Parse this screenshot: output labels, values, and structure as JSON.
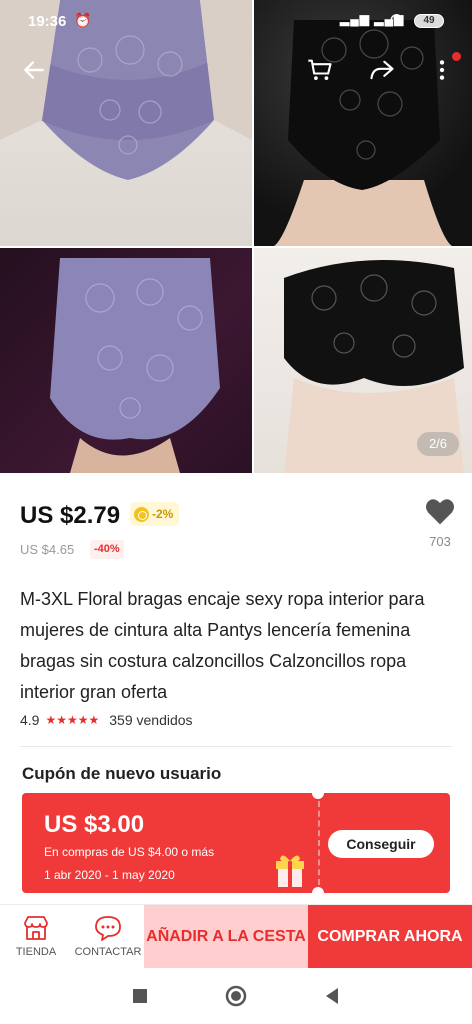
{
  "status_bar": {
    "time": "19:36",
    "battery": "49"
  },
  "gallery": {
    "pager": "2/6"
  },
  "product": {
    "price": "US $2.79",
    "coin_discount": "-2%",
    "original_price": "US $4.65",
    "discount": "-40%",
    "wishlist_count": "703",
    "title": "M-3XL Floral bragas encaje sexy ropa interior para mujeres de cintura alta Pantys lencería femenina bragas sin costura calzoncillos Calzoncillos ropa interior gran oferta",
    "rating": "4.9",
    "stars": "★★★★★",
    "sold": "359 vendidos"
  },
  "coupon": {
    "heading": "Cupón de nuevo usuario",
    "amount": "US $3.00",
    "condition": "En compras de US $4.00 o más",
    "dates": "1 abr 2020 - 1 may 2020",
    "button": "Conseguir"
  },
  "action_bar": {
    "store": "TIENDA",
    "contact": "CONTACTAR",
    "add_to_cart": "AÑADIR A LA CESTA",
    "buy_now": "COMPRAR AHORA"
  },
  "colors": {
    "accent": "#f03a3a",
    "accent_light": "#ffcfcf",
    "stars": "#e62e2e"
  },
  "icons": [
    "back-arrow-icon",
    "cart-icon",
    "share-icon",
    "more-icon",
    "heart-icon",
    "coin-icon",
    "store-icon",
    "chat-icon",
    "gift-icon"
  ]
}
